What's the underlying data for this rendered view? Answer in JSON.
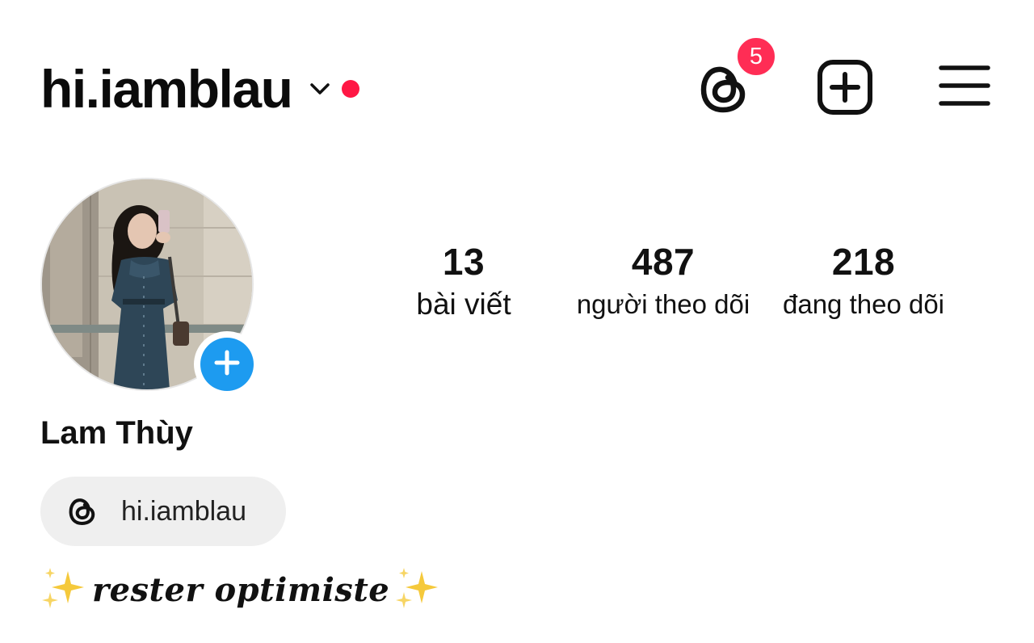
{
  "header": {
    "username": "hi.iamblau",
    "notification_count": "5",
    "colors": {
      "unread_dot": "#ff1744",
      "badge": "#ff2d55"
    }
  },
  "profile": {
    "stats": [
      {
        "count": "13",
        "label": "bài viết"
      },
      {
        "count": "487",
        "label": "người theo dõi"
      },
      {
        "count": "218",
        "label": "đang theo dõi"
      }
    ],
    "display_name": "Lam Thùy",
    "threads_handle": "hi.iamblau",
    "bio": "rester optimiste",
    "add_story_color": "#1d9bf0"
  },
  "icons": {
    "chevron": "chevron-down-icon",
    "threads": "threads-icon",
    "add": "add-square-icon",
    "menu": "hamburger-menu-icon",
    "sparkles": "sparkles-icon",
    "add_story": "plus-icon"
  }
}
